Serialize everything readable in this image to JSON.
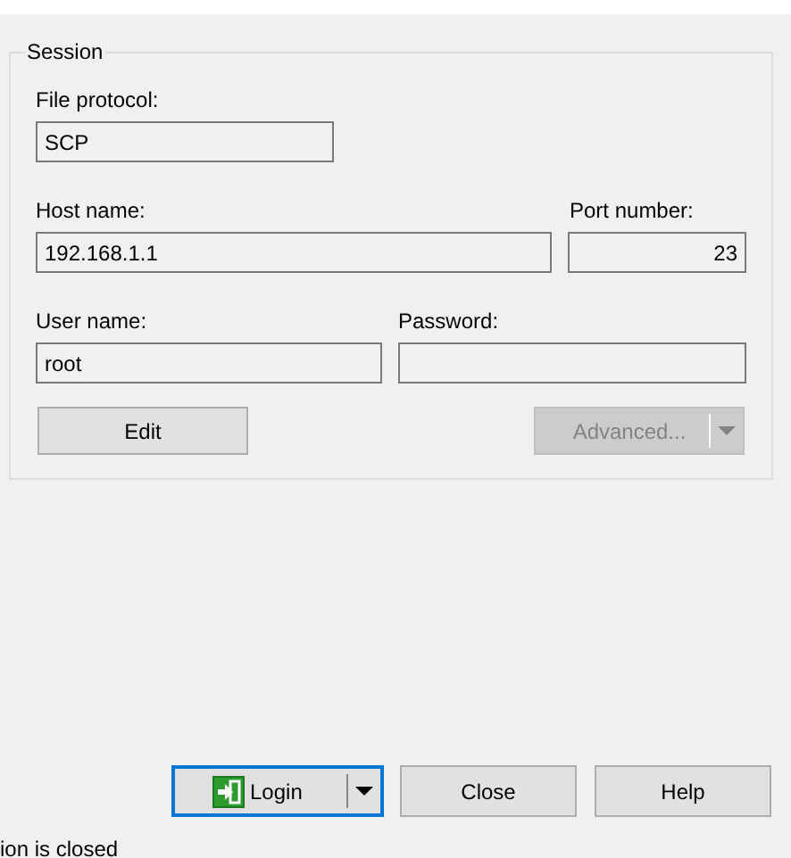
{
  "session": {
    "title": "Session",
    "rows": [
      [
        {
          "label": "File protocol:",
          "value": "SCP",
          "kind": "text"
        }
      ],
      [
        {
          "label": "Host name:",
          "value": "192.168.1.1",
          "kind": "text"
        },
        {
          "label": "Port number:",
          "value": "23",
          "kind": "number"
        }
      ],
      [
        {
          "label": "User name:",
          "value": "root",
          "kind": "text"
        },
        {
          "label": "Password:",
          "kind": "password"
        }
      ]
    ],
    "buttons": [
      {
        "label": "Edit",
        "disabled": false,
        "dropdown": false
      },
      {
        "label": "Advanced...",
        "disabled": true,
        "dropdown": true
      }
    ]
  },
  "footer_buttons": [
    {
      "label": "Login",
      "focused": true,
      "dropdown": true,
      "kind": "icon-button"
    },
    {
      "label": "Close",
      "focused": false,
      "dropdown": false
    },
    {
      "label": "Help",
      "focused": false,
      "dropdown": false
    }
  ],
  "status_bar": "ion is closed"
}
